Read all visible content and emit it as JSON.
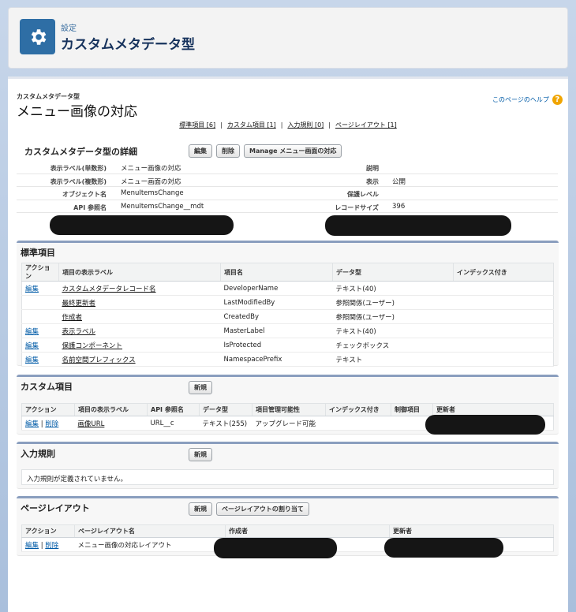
{
  "header": {
    "breadcrumb": "設定",
    "title": "カスタムメタデータ型",
    "icon": "gear-icon"
  },
  "page": {
    "crumb": "カスタムメタデータ型",
    "title": "メニュー画像の対応",
    "help_link": "このページのヘルプ",
    "help_icon": "?",
    "related_links": [
      "標準項目 [6]",
      "カスタム項目 [1]",
      "入力規則 [0]",
      "ページレイアウト [1]"
    ],
    "related_sep": "|"
  },
  "detail": {
    "title": "カスタムメタデータ型の詳細",
    "buttons": [
      "編集",
      "削除",
      "Manage メニュー画面の対応"
    ],
    "rows": [
      {
        "label": "表示ラベル(単数形)",
        "value": "メニュー画像の対応",
        "label2": "説明",
        "value2": ""
      },
      {
        "label": "表示ラベル(複数形)",
        "value": "メニュー画面の対応",
        "label2": "表示",
        "value2": "公開"
      },
      {
        "label": "オブジェクト名",
        "value": "MenuItemsChange",
        "label2": "保護レベル",
        "value2": ""
      },
      {
        "label": "API 参照名",
        "value": "MenuItemsChange__mdt",
        "label2": "レコードサイズ",
        "value2": "396"
      }
    ]
  },
  "standard_fields": {
    "title": "標準項目",
    "columns": [
      "アクション",
      "項目の表示ラベル",
      "項目名",
      "データ型",
      "インデックス付き"
    ],
    "rows": [
      {
        "action": "編集",
        "label": "カスタムメタデータレコード名",
        "name": "DeveloperName",
        "type": "テキスト(40)",
        "indexed": ""
      },
      {
        "action": "",
        "label": "最終更新者",
        "name": "LastModifiedBy",
        "type": "参照関係(ユーザー)",
        "indexed": ""
      },
      {
        "action": "",
        "label": "作成者",
        "name": "CreatedBy",
        "type": "参照関係(ユーザー)",
        "indexed": ""
      },
      {
        "action": "編集",
        "label": "表示ラベル",
        "name": "MasterLabel",
        "type": "テキスト(40)",
        "indexed": ""
      },
      {
        "action": "編集",
        "label": "保護コンポーネント",
        "name": "IsProtected",
        "type": "チェックボックス",
        "indexed": ""
      },
      {
        "action": "編集",
        "label": "名前空間プレフィックス",
        "name": "NamespacePrefix",
        "type": "テキスト",
        "indexed": ""
      }
    ]
  },
  "custom_fields": {
    "title": "カスタム項目",
    "new_button": "新規",
    "columns": [
      "アクション",
      "項目の表示ラベル",
      "API 参照名",
      "データ型",
      "項目管理可能性",
      "インデックス付き",
      "制御項目",
      "更新者"
    ],
    "rows": [
      {
        "edit": "編集",
        "sep": "|",
        "del": "削除",
        "label": "画像URL",
        "api": "URL__c",
        "type": "テキスト(255)",
        "manage": "アップグレード可能",
        "indexed": "",
        "control": ""
      }
    ]
  },
  "validation_rules": {
    "title": "入力規則",
    "new_button": "新規",
    "empty_text": "入力規則が定義されていません。"
  },
  "page_layouts": {
    "title": "ページレイアウト",
    "buttons": [
      "新規",
      "ページレイアウトの割り当て"
    ],
    "columns": [
      "アクション",
      "ページレイアウト名",
      "作成者",
      "更新者"
    ],
    "rows": [
      {
        "edit": "編集",
        "sep": "|",
        "del": "削除",
        "name": "メニュー画像の対応レイアウト"
      }
    ]
  },
  "colors": {
    "accent": "#2e6ea5",
    "link": "#015ba7",
    "help": "#f0a500",
    "section_border": "#8a9ebe"
  }
}
